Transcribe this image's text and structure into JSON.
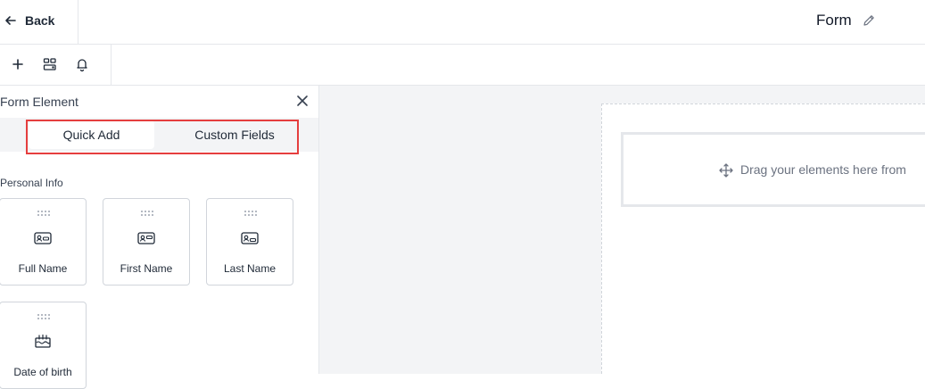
{
  "header": {
    "back_label": "Back",
    "form_title": "Form"
  },
  "toolbar": {
    "icons": [
      "plus-icon",
      "layout-icon",
      "bell-icon"
    ]
  },
  "panel": {
    "title": "Form Element",
    "tabs": [
      {
        "label": "Quick Add",
        "active": true
      },
      {
        "label": "Custom Fields",
        "active": false
      }
    ],
    "section": "Personal Info",
    "elements": [
      {
        "label": "Full Name",
        "icon": "id-card-icon"
      },
      {
        "label": "First Name",
        "icon": "id-card-icon"
      },
      {
        "label": "Last Name",
        "icon": "id-card-icon"
      },
      {
        "label": "Date of birth",
        "icon": "calendar-cake-icon"
      }
    ]
  },
  "canvas": {
    "drop_text": "Drag your elements here from"
  },
  "colors": {
    "highlight": "#e53e3e",
    "canvas_bg": "#f3f4f6",
    "border": "#e5e7eb"
  }
}
